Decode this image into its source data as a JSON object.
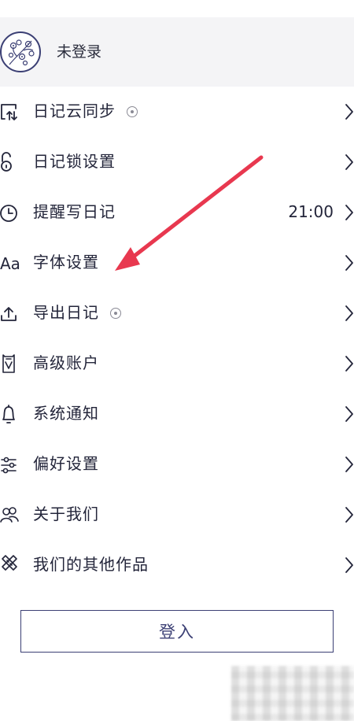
{
  "profile": {
    "name": "未登录"
  },
  "menu": [
    {
      "key": "sync",
      "label": "日记云同步",
      "icon": "cloud-sync-icon",
      "badge": true,
      "value": ""
    },
    {
      "key": "lock",
      "label": "日记锁设置",
      "icon": "lock-icon",
      "badge": false,
      "value": ""
    },
    {
      "key": "reminder",
      "label": "提醒写日记",
      "icon": "clock-icon",
      "badge": false,
      "value": "21:00"
    },
    {
      "key": "font",
      "label": "字体设置",
      "icon": "font-icon",
      "badge": false,
      "value": ""
    },
    {
      "key": "export",
      "label": "导出日记",
      "icon": "export-icon",
      "badge": true,
      "value": ""
    },
    {
      "key": "premium",
      "label": "高级账户",
      "icon": "premium-icon",
      "badge": false,
      "value": ""
    },
    {
      "key": "notify",
      "label": "系统通知",
      "icon": "bell-icon",
      "badge": false,
      "value": ""
    },
    {
      "key": "prefs",
      "label": "偏好设置",
      "icon": "sliders-icon",
      "badge": false,
      "value": ""
    },
    {
      "key": "about",
      "label": "关于我们",
      "icon": "people-icon",
      "badge": false,
      "value": ""
    },
    {
      "key": "works",
      "label": "我们的其他作品",
      "icon": "tools-icon",
      "badge": false,
      "value": ""
    }
  ],
  "login": {
    "label": "登入"
  },
  "colors": {
    "accent": "#3b3f74",
    "arrow": "#e8384f",
    "text": "#23253a"
  }
}
